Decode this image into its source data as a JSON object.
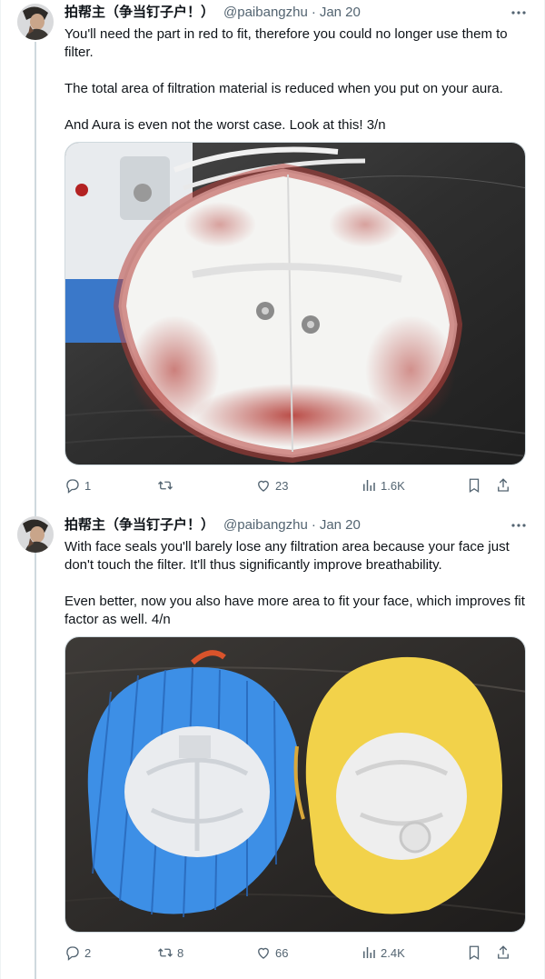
{
  "colors": {
    "text_primary": "#0f1419",
    "text_secondary": "#536471",
    "thread_line": "#cfd9de"
  },
  "tweets": [
    {
      "author_name": "拍帮主（争当钉子户！）",
      "handle": "@paibangzhu",
      "separator": "·",
      "date": "Jan 20",
      "text": "You'll need the part in red to fit, therefore you could no longer use them to filter.\n\nThe total area of filtration material is reduced when you put on your aura.\n\nAnd Aura is even not the worst case. Look at this! 3/n",
      "replies": "1",
      "retweets": "",
      "likes": "23",
      "views": "1.6K"
    },
    {
      "author_name": "拍帮主（争当钉子户！）",
      "handle": "@paibangzhu",
      "separator": "·",
      "date": "Jan 20",
      "text": "With face seals you'll barely lose any filtration area because your face just don't touch the filter. It'll thus significantly improve breathability.\n\nEven better, now you also have more area to fit your face, which improves fit factor as well. 4/n",
      "replies": "2",
      "retweets": "8",
      "likes": "66",
      "views": "2.4K"
    }
  ],
  "icons": {
    "more": "more-dots-icon",
    "reply": "reply-icon",
    "retweet": "retweet-icon",
    "like": "heart-icon",
    "views": "views-icon",
    "bookmark": "bookmark-icon",
    "share": "share-icon"
  }
}
